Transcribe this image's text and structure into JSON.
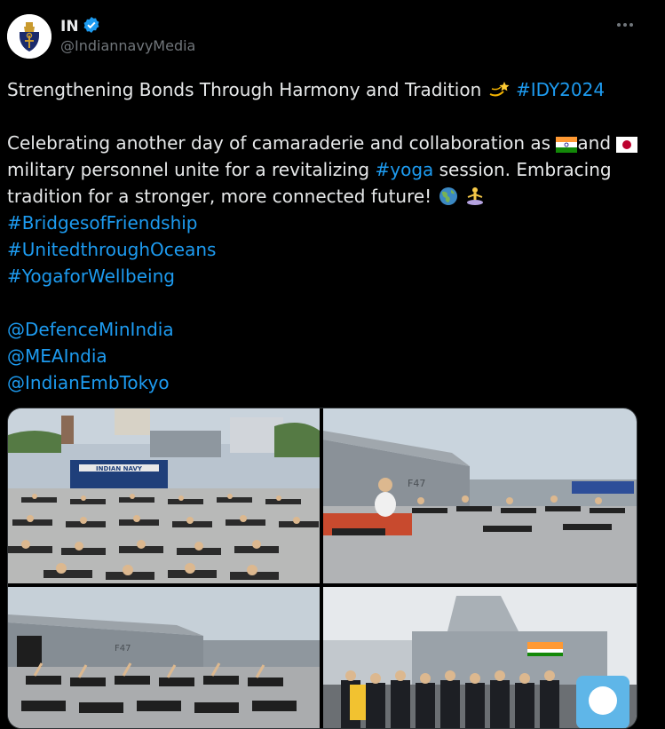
{
  "account": {
    "name": "IN",
    "handle": "@IndiannavyMedia",
    "verified": true,
    "avatar_icon": "indian-navy-crest"
  },
  "tweet": {
    "line1_text": "Strengthening Bonds Through Harmony and Tradition",
    "line1_emoji": "dizzy-emoji",
    "line1_hashtag": "#IDY2024",
    "line2_a": "Celebrating another day of camaraderie and collaboration as",
    "line2_flag1": "india-flag",
    "line2_and": "and",
    "line2_flag2": "japan-flag",
    "line3_a": "military personnel unite for a revitalizing",
    "line3_hashtag": "#yoga",
    "line3_b": "session. Embracing",
    "line4_a": "tradition for a stronger, more connected future!",
    "line4_emojis": [
      "globe-emoji",
      "person-in-lotus-position-emoji"
    ],
    "hashtags": [
      "#BridgesofFriendship",
      "#UnitedthroughOceans",
      "#YogaforWellbeing"
    ],
    "mentions": [
      "@DefenceMinIndia",
      "@MEAIndia",
      "@IndianEmbTokyo"
    ]
  },
  "media": {
    "photos": [
      {
        "subject": "Rows of personnel lying on mats on a pier with an Indian Navy banner and buildings behind",
        "banner_text": "INDIAN NAVY"
      },
      {
        "subject": "Personnel in cobra pose beside a grey warship",
        "hull_number": "F47"
      },
      {
        "subject": "Personnel doing side stretches on a pier next to warship",
        "hull_number": "F47"
      },
      {
        "subject": "Group photo in front of a warship with a yoga day poster"
      }
    ]
  },
  "colors": {
    "background": "#000000",
    "text": "#e7e9ea",
    "secondary": "#71767b",
    "link": "#1d9bf0",
    "verified": "#1d9bf0"
  }
}
